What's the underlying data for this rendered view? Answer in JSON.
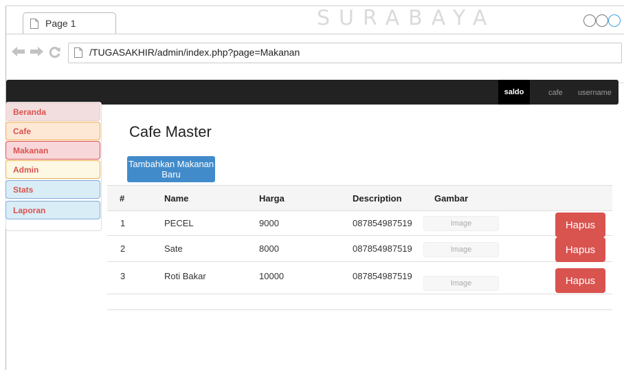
{
  "browser": {
    "tab_title": "Page 1",
    "watermark": "SURABAYA",
    "url": "/TUGASAKHIR/admin/index.php?page=Makanan"
  },
  "navbar": {
    "saldo": "saldo",
    "cafe": "cafe",
    "username": "username"
  },
  "sidebar": {
    "items": [
      {
        "label": "Beranda"
      },
      {
        "label": "Cafe"
      },
      {
        "label": "Makanan"
      },
      {
        "label": "Admin"
      },
      {
        "label": "Stats"
      },
      {
        "label": "Laporan"
      }
    ]
  },
  "main": {
    "title": "Cafe Master",
    "add_button": "Tambahkan Makanan Baru",
    "table": {
      "headers": [
        "#",
        "Name",
        "Harga",
        "Description",
        "Gambar"
      ],
      "rows": [
        {
          "no": "1",
          "name": "PECEL",
          "harga": "9000",
          "description": "087854987519",
          "image": "Image",
          "action": "Hapus"
        },
        {
          "no": "2",
          "name": "Sate",
          "harga": "8000",
          "description": "087854987519",
          "image": "Image",
          "action": "Hapus"
        },
        {
          "no": "3",
          "name": "Roti Bakar",
          "harga": "10000",
          "description": "087854987519",
          "image": "Image",
          "action": "Hapus"
        }
      ]
    }
  },
  "colors": {
    "navbar_bg": "#222222",
    "primary": "#428bca",
    "danger": "#d9534f"
  }
}
